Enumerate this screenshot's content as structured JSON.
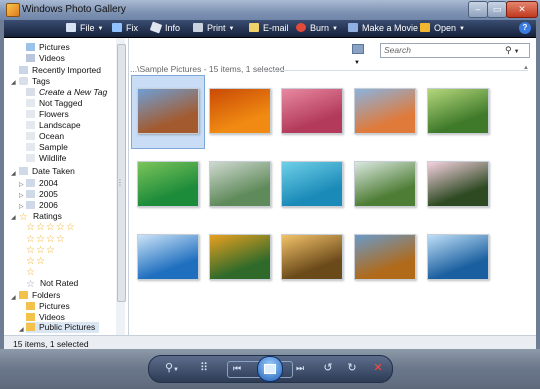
{
  "window": {
    "title": "Windows Photo Gallery"
  },
  "toolbar": {
    "file": "File",
    "fix": "Fix",
    "info": "Info",
    "print": "Print",
    "email": "E-mail",
    "burn": "Burn",
    "make_movie": "Make a Movie",
    "open": "Open",
    "help": "?"
  },
  "nav": {
    "items": {
      "pictures": "Pictures",
      "videos": "Videos",
      "recently_imported": "Recently Imported",
      "tags": "Tags",
      "create_tag": "Create a New Tag",
      "not_tagged": "Not Tagged",
      "flowers": "Flowers",
      "landscape": "Landscape",
      "ocean": "Ocean",
      "sample": "Sample",
      "wildlife": "Wildlife",
      "date_taken": "Date Taken",
      "y2004": "2004",
      "y2005": "2005",
      "y2006": "2006",
      "ratings": "Ratings",
      "not_rated": "Not Rated",
      "folders": "Folders",
      "f_pictures": "Pictures",
      "f_videos": "Videos",
      "public_pictures": "Public Pictures"
    }
  },
  "search": {
    "placeholder": "Search"
  },
  "group": {
    "header": "...\\Sample Pictures - 15 items, 1 selected"
  },
  "status": {
    "text": "15 items, 1 selected"
  },
  "thumbnails": [
    {
      "name": "desert-butte",
      "c1": "#a35a2e",
      "c2": "#6f9fd5"
    },
    {
      "name": "orange-flowers",
      "c1": "#f08a12",
      "c2": "#c94a06"
    },
    {
      "name": "pink-flowers",
      "c1": "#b33a5a",
      "c2": "#e889a1"
    },
    {
      "name": "desert-dunes",
      "c1": "#e07a3a",
      "c2": "#8ab3e0"
    },
    {
      "name": "forest",
      "c1": "#3f7a2a",
      "c2": "#b5d77b"
    },
    {
      "name": "green-leaves",
      "c1": "#1c8b3a",
      "c2": "#7bc45a"
    },
    {
      "name": "river-valley",
      "c1": "#5f8a5a",
      "c2": "#cfd9d0"
    },
    {
      "name": "sea-turtle",
      "c1": "#1a8ab8",
      "c2": "#6fd0e8"
    },
    {
      "name": "waterfall",
      "c1": "#4e7d35",
      "c2": "#dbe8e0"
    },
    {
      "name": "frangipani",
      "c1": "#2d4a22",
      "c2": "#f6d2e0"
    },
    {
      "name": "dock-lake",
      "c1": "#1f6fbf",
      "c2": "#cbe3f7"
    },
    {
      "name": "toucan",
      "c1": "#2f6a2a",
      "c2": "#e8a020"
    },
    {
      "name": "tree-sunset",
      "c1": "#6b4a1a",
      "c2": "#f3c36a"
    },
    {
      "name": "autumn-lake",
      "c1": "#b06a1a",
      "c2": "#6a9ac9"
    },
    {
      "name": "humpback-whale",
      "c1": "#1a5f9f",
      "c2": "#bfdff7"
    }
  ]
}
